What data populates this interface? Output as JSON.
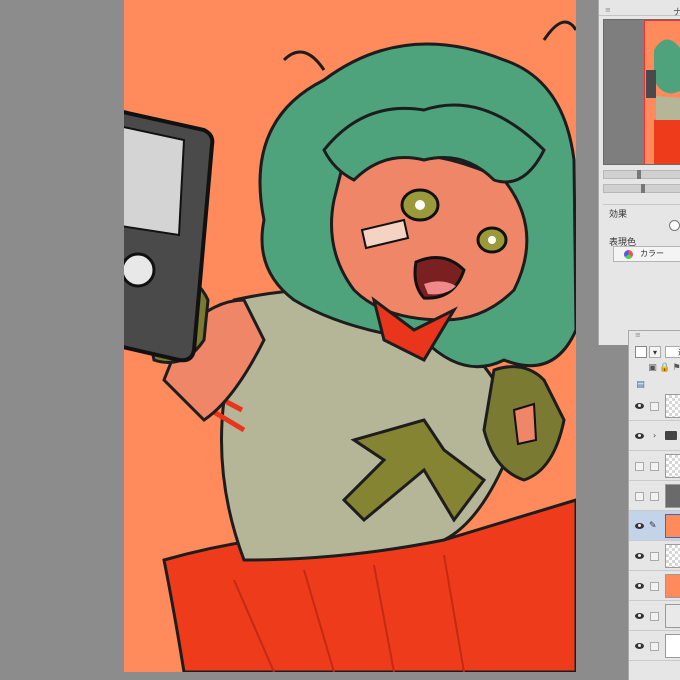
{
  "app": {
    "canvas_background": "#ff8a5c",
    "workspace_color": "#8c8c8c",
    "accent_selected": "#c3d4ea"
  },
  "navigator": {
    "title": "ナ",
    "zoom_slider_level": 0.45,
    "rotate_slider_level": 0.5
  },
  "effect_panel": {
    "effect_label": "効果",
    "expression_color_label": "表現色",
    "expression_color_value": "カラー"
  },
  "layer_panel": {
    "blend_mode": "通",
    "dropdown_glyph": "▾",
    "layers": [
      {
        "kind": "raster",
        "visible": true,
        "thumb": "transparent"
      },
      {
        "kind": "folder",
        "visible": true,
        "thumb": "folder"
      },
      {
        "kind": "raster",
        "visible": false,
        "thumb": "transparent"
      },
      {
        "kind": "raster",
        "visible": false,
        "thumb": "lineart"
      },
      {
        "kind": "raster",
        "visible": true,
        "thumb": "character",
        "selected": true
      },
      {
        "kind": "raster",
        "visible": true,
        "thumb": "transparent"
      },
      {
        "kind": "fill",
        "visible": true,
        "thumb": "#ff8a5c"
      },
      {
        "kind": "paper",
        "visible": true,
        "thumb": "#e9e9e9"
      },
      {
        "kind": "paper",
        "visible": true,
        "thumb": "#ffffff"
      }
    ]
  },
  "icons": {
    "pencil": "pencil-icon",
    "eye": "eye-icon",
    "folder": "folder-icon",
    "lock": "lock-icon"
  }
}
